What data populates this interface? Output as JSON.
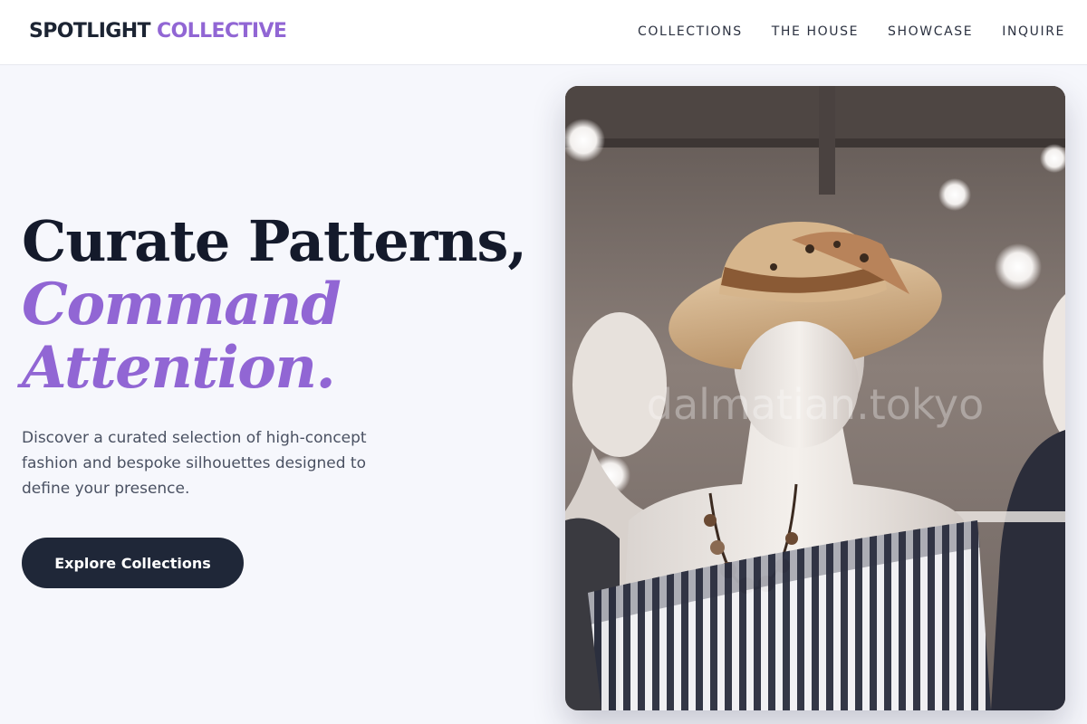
{
  "brand": {
    "word1": "SPOTLIGHT",
    "word2": "COLLECTIVE",
    "accent_color": "#9166d4"
  },
  "nav": {
    "items": [
      {
        "label": "COLLECTIONS"
      },
      {
        "label": "THE HOUSE"
      },
      {
        "label": "SHOWCASE"
      },
      {
        "label": "INQUIRE"
      }
    ]
  },
  "hero": {
    "title_line1": "Curate Patterns,",
    "title_line2": "Command",
    "title_line3": "Attention.",
    "description": "Discover a curated selection of high-concept fashion and bespoke silhouettes designed to define your presence.",
    "cta_label": "Explore Collections",
    "cta_color": "#1f2738"
  },
  "photo": {
    "watermark": "dalmatian.tokyo"
  }
}
